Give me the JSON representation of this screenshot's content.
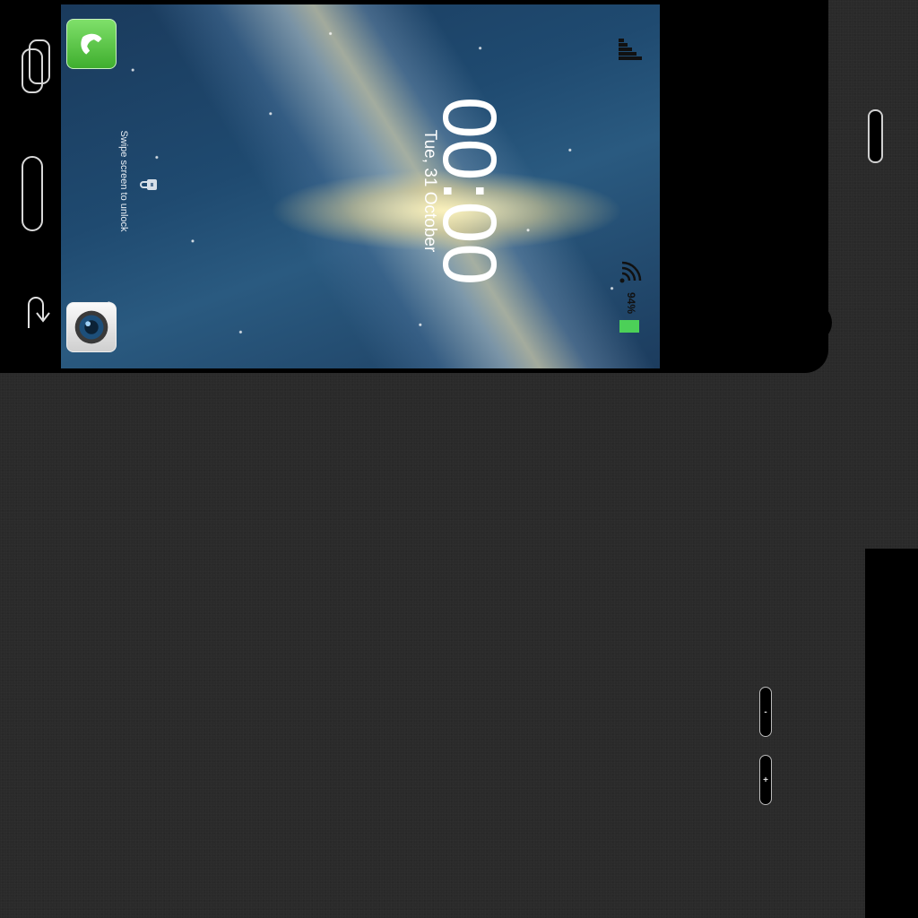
{
  "lockscreen": {
    "time": "00:00",
    "date": "Tue, 31 October",
    "unlock_hint": "Swipe screen to unlock",
    "battery_percent": "94%",
    "battery_level": 0.94
  },
  "shortcuts": {
    "phone": {
      "icon": "phone-handset-icon"
    },
    "camera": {
      "icon": "camera-lens-icon"
    }
  },
  "hardware_buttons": {
    "volume_down_label": "-",
    "volume_up_label": "+"
  },
  "colors": {
    "accent_green": "#4cd058",
    "phone_icon_green": "#5fc94a",
    "device_black": "#000000",
    "background": "#2a2a2a"
  }
}
